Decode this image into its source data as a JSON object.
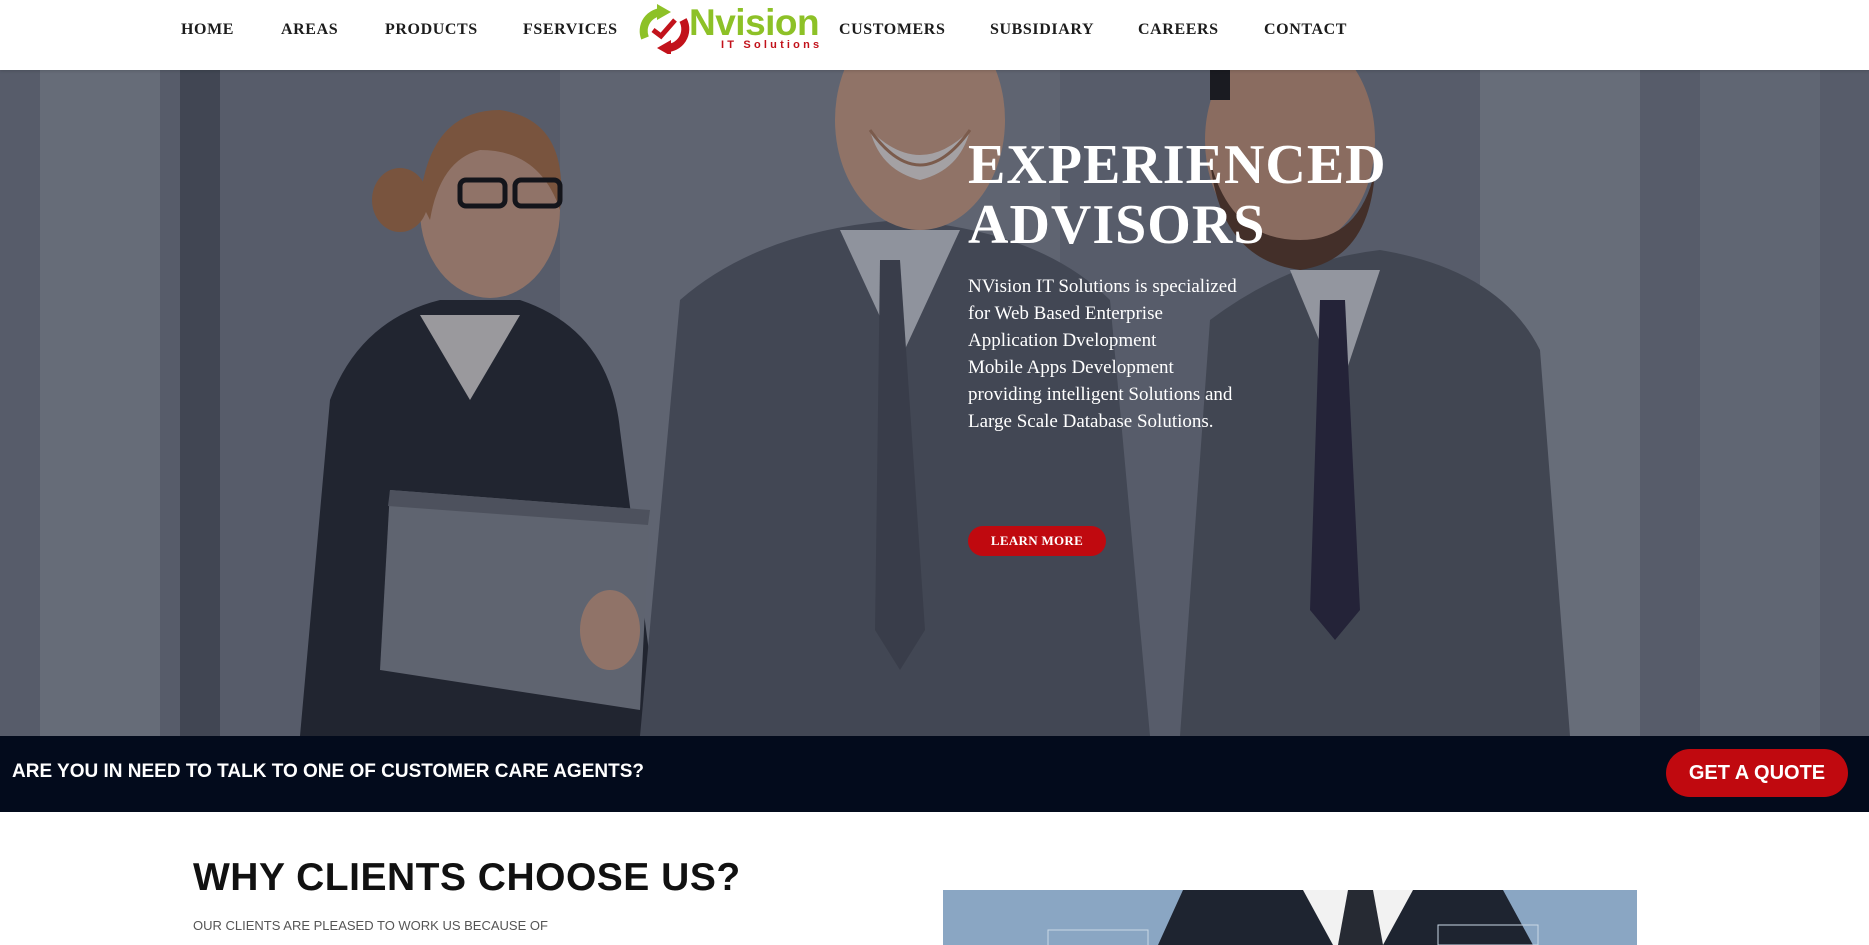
{
  "nav": {
    "items": [
      {
        "label": "HOME"
      },
      {
        "label": "AREAS"
      },
      {
        "label": "PRODUCTS"
      },
      {
        "label": "FSERVICES"
      },
      {
        "label": "CUSTOMERS"
      },
      {
        "label": "SUBSIDIARY"
      },
      {
        "label": "CAREERS"
      },
      {
        "label": "CONTACT"
      }
    ]
  },
  "logo": {
    "word": "Nvision",
    "tagline": "IT Solutions",
    "colors": {
      "green": "#8dc127",
      "red": "#c2121b"
    }
  },
  "hero": {
    "title_line1": "EXPERIENCED",
    "title_line2": "ADVISORS",
    "desc_lines": [
      "NVision IT Solutions is specialized",
      "for Web Based Enterprise",
      "Application Dvelopment",
      "Mobile Apps Development",
      "providing intelligent Solutions and",
      "Large Scale Database Solutions."
    ],
    "button_label": "LEARN MORE"
  },
  "cta": {
    "text": "ARE YOU IN NEED TO TALK TO ONE OF CUSTOMER CARE AGENTS?",
    "button_label": "GET A QUOTE"
  },
  "why": {
    "title": "WHY CLIENTS CHOOSE US?",
    "subtitle": "OUR CLIENTS ARE PLEASED TO WORK US BECAUSE OF"
  },
  "colors": {
    "accent_red": "#c0090f",
    "cta_bar": "#030b1c"
  }
}
